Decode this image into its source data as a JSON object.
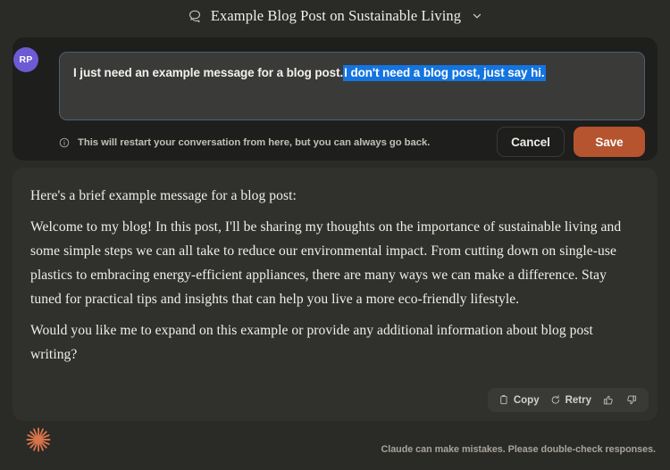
{
  "header": {
    "icon": "chat-bubble-icon",
    "title": "Example Blog Post on Sustainable Living",
    "chevron": "chevron-down-icon"
  },
  "edit": {
    "avatar_initials": "RP",
    "message_prefix": "I just need an example message for a blog post.",
    "message_selected": "I don't need a blog post, just say hi.",
    "warning_icon": "info-icon",
    "warning_text": "This will restart your conversation from here, but you can always go back.",
    "cancel_label": "Cancel",
    "save_label": "Save",
    "selection_color": "#1474e0",
    "save_color": "#b5542f"
  },
  "response": {
    "paragraphs": [
      "Here's a brief example message for a blog post:",
      "Welcome to my blog! In this post, I'll be sharing my thoughts on the importance of sustainable living and some simple steps we can all take to reduce our environmental impact. From cutting down on single-use plastics to embracing energy-efficient appliances, there are many ways we can make a difference. Stay tuned for practical tips and insights that can help you live a more eco-friendly lifestyle.",
      "Would you like me to expand on this example or provide any additional information about blog post writing?"
    ],
    "actions": {
      "copy_label": "Copy",
      "copy_icon": "clipboard-icon",
      "retry_label": "Retry",
      "retry_icon": "refresh-icon",
      "thumbs_up_icon": "thumbs-up-icon",
      "thumbs_down_icon": "thumbs-down-icon"
    }
  },
  "footer": {
    "logo_icon": "claude-starburst-logo",
    "logo_color": "#d8734a",
    "note": "Claude can make mistakes. Please double-check responses."
  }
}
